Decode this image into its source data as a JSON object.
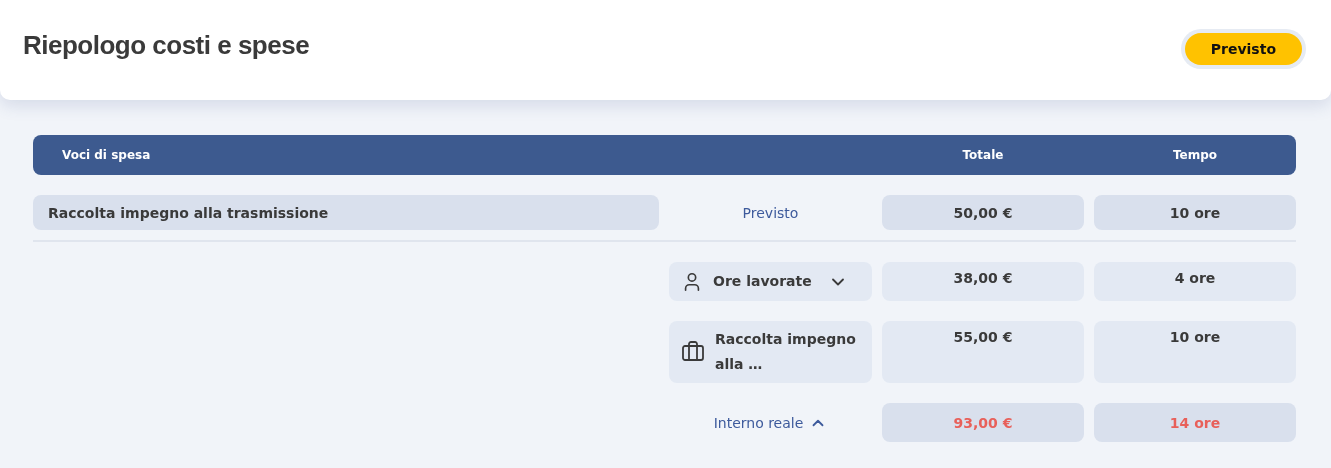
{
  "header": {
    "title": "Riepologo costi e spese",
    "badge": "Previsto"
  },
  "table": {
    "columns": [
      "Voci di spesa",
      "Totale",
      "Tempo"
    ],
    "main_row": {
      "name": "Raccolta impegno alla trasmissione",
      "label": "Previsto",
      "total": "50,00 €",
      "time": "10 ore"
    },
    "details": [
      {
        "kind": "person",
        "label": "Ore lavorate",
        "has_dropdown": true,
        "total": "38,00 €",
        "time": "4 ore"
      },
      {
        "kind": "briefcase",
        "label": "Raccolta impegno alla …",
        "has_dropdown": false,
        "total": "55,00 €",
        "time": "10 ore"
      }
    ],
    "summary": {
      "label": "Interno reale",
      "expanded": true,
      "over_budget": true,
      "total": "93,00 €",
      "time": "14 ore"
    }
  }
}
